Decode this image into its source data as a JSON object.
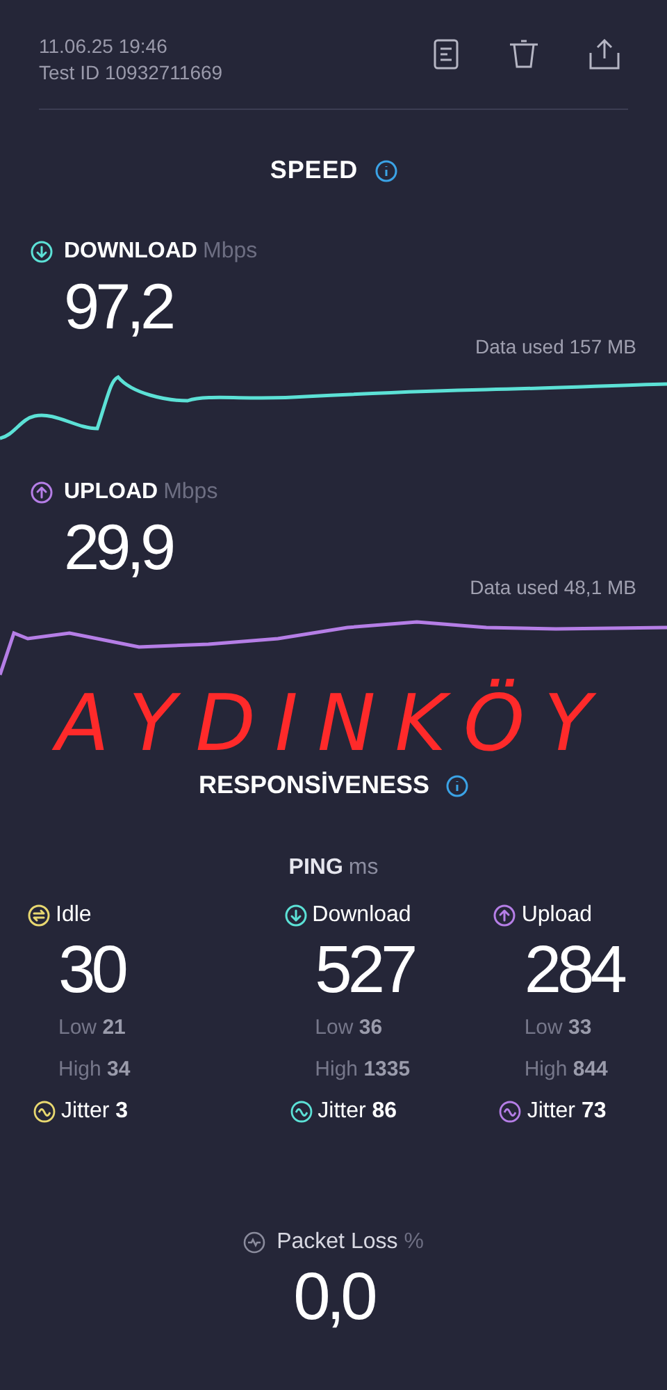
{
  "header": {
    "date": "11.06.25 19:46",
    "test_id": "Test ID 10932711669"
  },
  "speed": {
    "title": "SPEED",
    "metrics": [
      {
        "kind": "download",
        "label": "DOWNLOAD",
        "unit": "Mbps",
        "value": "97,2",
        "data_used": "Data used 157 MB",
        "color": "#5ce1d6"
      },
      {
        "kind": "upload",
        "label": "UPLOAD",
        "unit": "Mbps",
        "value": "29,9",
        "data_used": "Data used 48,1 MB",
        "color": "#b57ee6"
      }
    ]
  },
  "annotation": "AYDINKÖY",
  "responsiveness": {
    "title": "RESPONSİVENESS",
    "ping_label": "PING",
    "ping_unit": "ms",
    "columns": [
      {
        "kind": "idle",
        "label": "Idle",
        "value": "30",
        "low_label": "Low",
        "low": "21",
        "high_label": "High",
        "high": "34",
        "jitter_label": "Jitter",
        "jitter": "3",
        "color": "#e8d870"
      },
      {
        "kind": "download",
        "label": "Download",
        "value": "527",
        "low_label": "Low",
        "low": "36",
        "high_label": "High",
        "high": "1335",
        "jitter_label": "Jitter",
        "jitter": "86",
        "color": "#5ce1d6"
      },
      {
        "kind": "upload",
        "label": "Upload",
        "value": "284",
        "low_label": "Low",
        "low": "33",
        "high_label": "High",
        "high": "844",
        "jitter_label": "Jitter",
        "jitter": "73",
        "color": "#b57ee6"
      }
    ]
  },
  "packet_loss": {
    "label": "Packet Loss",
    "unit": "%",
    "value": "0,0"
  }
}
